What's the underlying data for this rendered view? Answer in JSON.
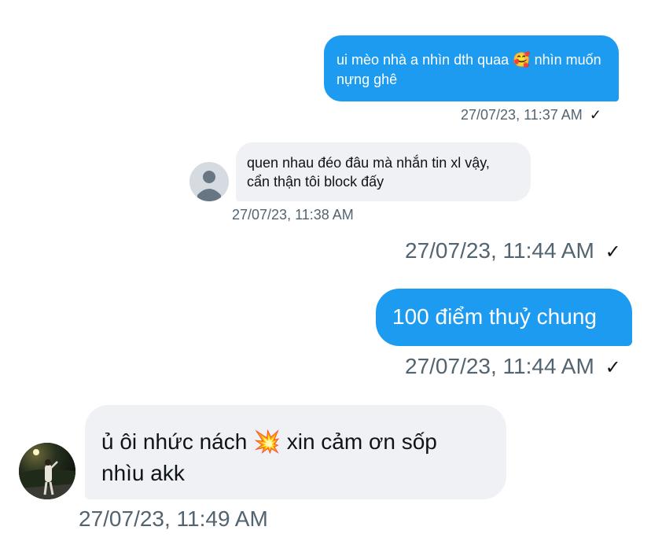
{
  "messages": [
    {
      "id": "m1",
      "direction": "sent",
      "text": "ui mèo nhà a nhìn dth quaa 🥰 nhìn muốn nựng ghê",
      "timestamp": "27/07/23, 11:37 AM",
      "status": "sent-check"
    },
    {
      "id": "m2",
      "direction": "received",
      "text": "quen nhau đéo đâu mà nhắn tin xl vậy, cẩn thận tôi block đấy",
      "timestamp": "27/07/23, 11:38 AM",
      "avatar": "default-avatar"
    },
    {
      "id": "m3",
      "direction": "sent",
      "timestamp": "27/07/23, 11:44 AM",
      "status": "sent-check"
    },
    {
      "id": "m4",
      "direction": "sent",
      "text": "100 điểm thuỷ chung",
      "timestamp": "27/07/23, 11:44 AM",
      "status": "sent-check"
    },
    {
      "id": "m5",
      "direction": "received",
      "text": "ủ ôi nhức nách 💥 xin cảm ơn sốp nhìu akk",
      "timestamp": "27/07/23, 11:49 AM",
      "avatar": "photo-avatar"
    }
  ],
  "colors": {
    "sent_bubble": "#1d9bf0",
    "received_bubble": "#eff1f4",
    "timestamp": "#536471"
  },
  "icons": {
    "check": "✓"
  }
}
